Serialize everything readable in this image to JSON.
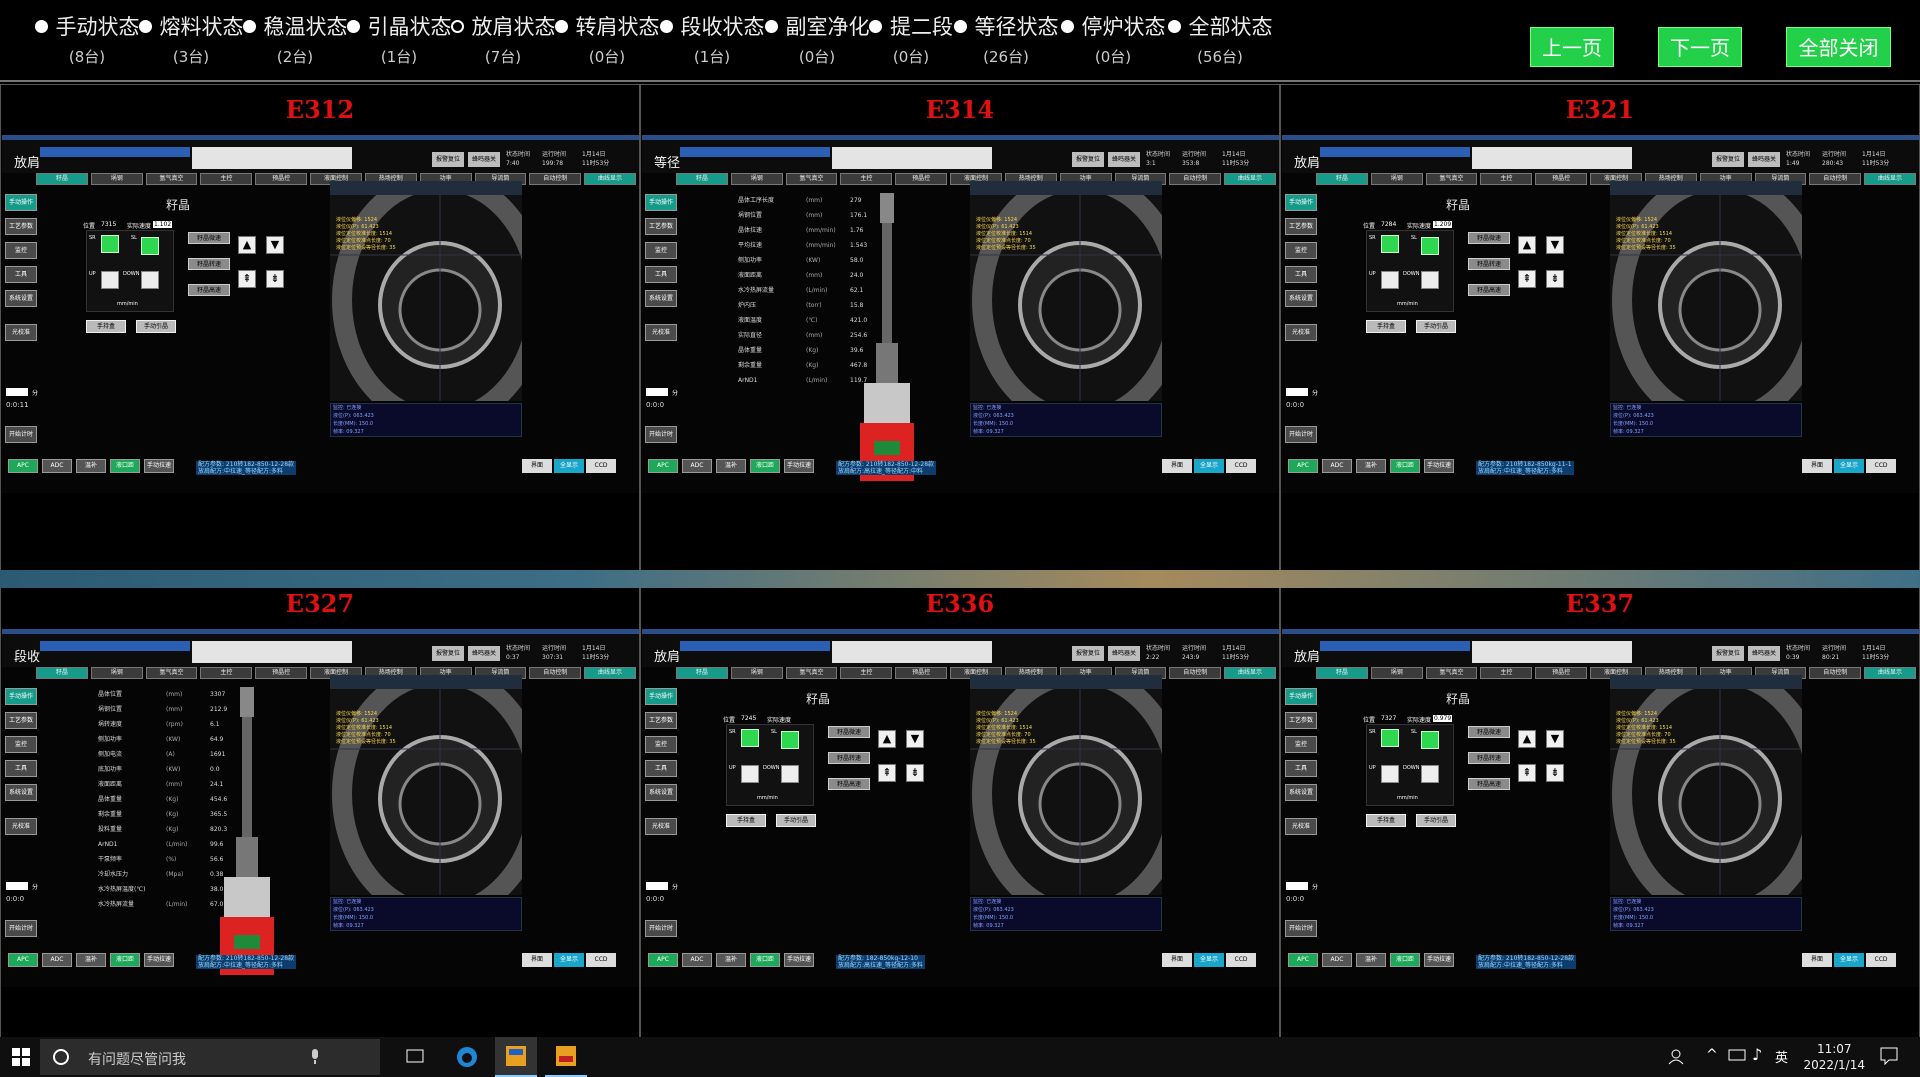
{
  "status_filters": [
    {
      "label": "手动状态",
      "count": "(8台)",
      "selected": false
    },
    {
      "label": "熔料状态",
      "count": "(3台)",
      "selected": false
    },
    {
      "label": "稳温状态",
      "count": "(2台)",
      "selected": false
    },
    {
      "label": "引晶状态",
      "count": "(1台)",
      "selected": false
    },
    {
      "label": "放肩状态",
      "count": "(7台)",
      "selected": true
    },
    {
      "label": "转肩状态",
      "count": "(0台)",
      "selected": false
    },
    {
      "label": "段收状态",
      "count": "(1台)",
      "selected": false
    },
    {
      "label": "副室净化",
      "count": "(0台)",
      "selected": false
    },
    {
      "label": "提二段",
      "count": "(0台)",
      "selected": false
    },
    {
      "label": "等径状态",
      "count": "(26台)",
      "selected": false
    },
    {
      "label": "停炉状态",
      "count": "(0台)",
      "selected": false
    },
    {
      "label": "全部状态",
      "count": "(56台)",
      "selected": false
    }
  ],
  "nav": {
    "prev": "上一页",
    "next": "下一页",
    "close_all": "全部关闭"
  },
  "panels": [
    {
      "id": "E312",
      "state": "放肩",
      "view": "seed",
      "time_label": "状态时间",
      "time": "7:40",
      "run_label": "运行时间",
      "run": "199:78",
      "date": "1月14日",
      "clock": "11时53分",
      "seed_title": "籽晶",
      "pos": "7315",
      "speed": "1.102",
      "recipe1": "配方参数: 210转182-850-12-28款",
      "recipe2": "放肩配方:中拉速_等径配方:多料",
      "timer": "0:0:11"
    },
    {
      "id": "E314",
      "state": "等径",
      "view": "furnace",
      "time_label": "状态时间",
      "time": "3:1",
      "run_label": "运行时间",
      "run": "353:8",
      "date": "1月14日",
      "clock": "11时53分",
      "params": [
        [
          "晶体工序长度",
          "(mm)",
          "279"
        ],
        [
          "埚钢位置",
          "(mm)",
          "176.1"
        ],
        [
          "晶体拉速",
          "(mm/min)",
          "1.76"
        ],
        [
          "平均拉速",
          "(mm/min)",
          "1.543"
        ],
        [
          "侧加功率",
          "(KW)",
          "58.0"
        ],
        [
          "液面距离",
          "(mm)",
          "24.0"
        ],
        [
          "水冷热屏流量",
          "(L/min)",
          "62.1"
        ],
        [
          "炉内压",
          "(torr)",
          "15.8"
        ],
        [
          "液面温度",
          "(℃)",
          "421.0"
        ],
        [
          "实际直径",
          "(mm)",
          "254.6"
        ],
        [
          "晶体重量",
          "(Kg)",
          "39.6"
        ],
        [
          "剩余重量",
          "(Kg)",
          "467.8"
        ],
        [
          "ArND1",
          "(L/min)",
          "119.7"
        ]
      ],
      "recipe1": "配方参数: 210转182-850-12-28款",
      "recipe2": "放肩配方:高拉速_等径配方:中料",
      "timer": "0:0:0"
    },
    {
      "id": "E321",
      "state": "放肩",
      "view": "seed",
      "time_label": "状态时间",
      "time": "1:49",
      "run_label": "运行时间",
      "run": "280:43",
      "date": "1月14日",
      "clock": "11时53分",
      "seed_title": "籽晶",
      "pos": "7284",
      "speed": "1.209",
      "recipe1": "配方参数: 210转182-850kg-11-1",
      "recipe2": "放肩配方:中拉速_等径配方:多料",
      "timer": "0:0:0"
    },
    {
      "id": "E327",
      "state": "段收",
      "view": "furnace",
      "time_label": "状态时间",
      "time": "0:37",
      "run_label": "运行时间",
      "run": "307:31",
      "date": "1月14日",
      "clock": "11时53分",
      "params": [
        [
          "晶体位置",
          "(mm)",
          "3307"
        ],
        [
          "埚钢位置",
          "(mm)",
          "212.9"
        ],
        [
          "埚转速度",
          "(rpm)",
          "6.1"
        ],
        [
          "侧加功率",
          "(KW)",
          "64.9"
        ],
        [
          "侧加电流",
          "(A)",
          "1691"
        ],
        [
          "底加功率",
          "(KW)",
          "0.0"
        ],
        [
          "液面距离",
          "(mm)",
          "24.1"
        ],
        [
          "晶体重量",
          "(Kg)",
          "454.6"
        ],
        [
          "剩余重量",
          "(Kg)",
          "365.5"
        ],
        [
          "投料重量",
          "(Kg)",
          "820.3"
        ],
        [
          "ArND1",
          "(L/min)",
          "99.6"
        ],
        [
          "干泵频率",
          "(%)",
          "56.6"
        ],
        [
          "冷却水压力",
          "(Mpa)",
          "0.38"
        ],
        [
          "水冷热屏温度(℃)",
          "",
          "38.0"
        ],
        [
          "水冷热屏流量",
          "(L/min)",
          "67.0"
        ]
      ],
      "recipe1": "配方参数: 210转182-850-12-28款",
      "recipe2": "放肩配方:中拉速_等径配方:多料",
      "timer": "0:0:0"
    },
    {
      "id": "E336",
      "state": "放肩",
      "view": "seed",
      "time_label": "状态时间",
      "time": "2:22",
      "run_label": "运行时间",
      "run": "243:9",
      "date": "1月14日",
      "clock": "11时53分",
      "seed_title": "籽晶",
      "pos": "7245",
      "speed": "",
      "recipe1": "配方参数: 182-850kg-12-10",
      "recipe2": "放肩配方:高拉速_等径配方:多料",
      "timer": "0:0:0"
    },
    {
      "id": "E337",
      "state": "放肩",
      "view": "seed",
      "time_label": "状态时间",
      "time": "0:39",
      "run_label": "运行时间",
      "run": "80:21",
      "date": "1月14日",
      "clock": "11时53分",
      "seed_title": "籽晶",
      "pos": "7327",
      "speed": "0.979",
      "recipe1": "配方参数: 210转182-850-12-28款",
      "recipe2": "放肩配方:中拉速_等径配方:多料",
      "timer": "0:0:0"
    }
  ],
  "common": {
    "tabs": [
      "籽晶",
      "埚钢",
      "氩气真空",
      "主控",
      "预晶控",
      "液面控制",
      "热场控制",
      "功率",
      "导流筒",
      "自动控制",
      "曲线显示"
    ],
    "side_buttons": [
      "手动操作",
      "工艺参数",
      "监控",
      "工具",
      "系统设置",
      "光校准",
      "开始计时"
    ],
    "bottom_left": [
      "APC",
      "ADC",
      "温补",
      "液口距",
      "手动拉速"
    ],
    "bottom_right": [
      "界面",
      "全显示",
      "CCD"
    ],
    "hbtn1": "报警复位",
    "hbtn2": "蜂鸣器关",
    "plate_btns": [
      "籽晶微速",
      "籽晶转速",
      "籽晶高速"
    ],
    "handbtns": [
      "手持盒",
      "手动引晶"
    ],
    "rpm": "rpm",
    "mmmin": "mm/min",
    "sr": "SR",
    "sl": "SL",
    "up": "UP",
    "down": "DOWN",
    "pos_label": "位置",
    "speed_label": "实际速度",
    "min_label": "分",
    "cam_text": [
      "液位仪偏移: 1524",
      "液位仪(P): 61.423",
      "液位定位校准长度: 1514",
      "液位定位校准点长度: 70",
      "液位定位预设等径长度: 35"
    ],
    "readout": [
      "监控: 已连接",
      "液位(P): 063.423",
      "长度(MM): 150.0",
      "帧率: 09.327"
    ]
  },
  "taskbar": {
    "search": "有问题尽管问我",
    "time": "11:07",
    "date": "2022/1/14",
    "ime": "英"
  }
}
